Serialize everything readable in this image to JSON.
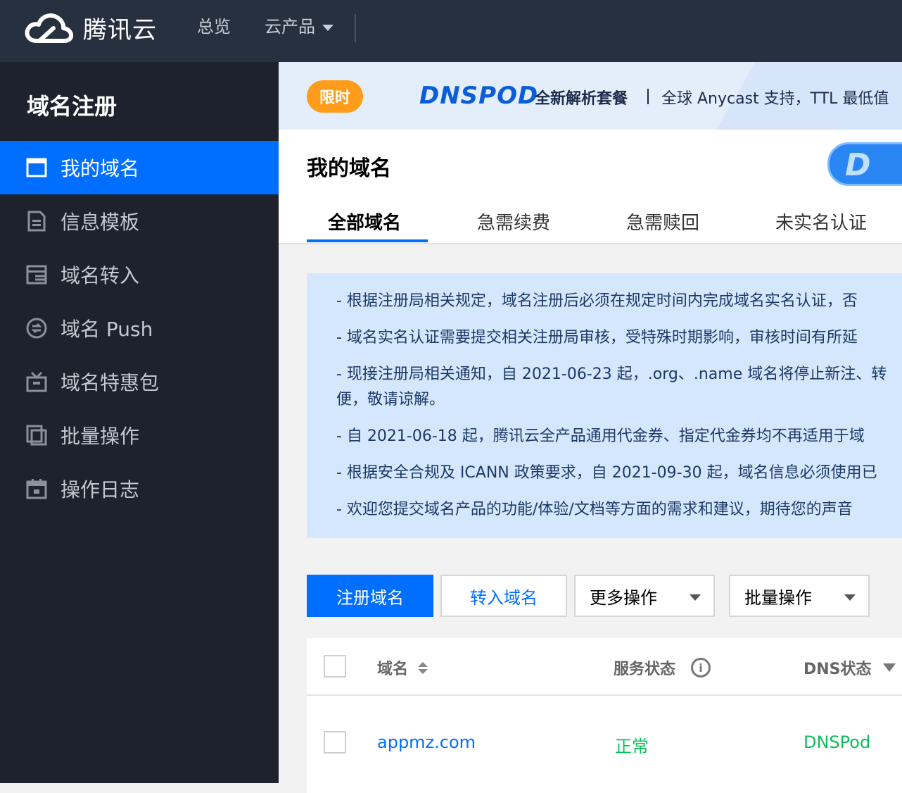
{
  "header": {
    "brand": "腾讯云",
    "nav": {
      "overview": "总览",
      "products": "云产品"
    }
  },
  "sidebar": {
    "title": "域名注册",
    "items": [
      {
        "label": "我的域名",
        "icon": "window-icon",
        "active": true
      },
      {
        "label": "信息模板",
        "icon": "document-icon"
      },
      {
        "label": "域名转入",
        "icon": "transfer-icon"
      },
      {
        "label": "域名 Push",
        "icon": "push-icon"
      },
      {
        "label": "域名特惠包",
        "icon": "gift-icon"
      },
      {
        "label": "批量操作",
        "icon": "copy-icon"
      },
      {
        "label": "操作日志",
        "icon": "calendar-icon"
      }
    ]
  },
  "banner": {
    "badge": "限时",
    "logo": "DNSPOD",
    "title": "全新解析套餐",
    "desc": "全球 Anycast 支持，TTL 最低值"
  },
  "page": {
    "title": "我的域名",
    "promo_letter": "D",
    "tabs": [
      "全部域名",
      "急需续费",
      "急需赎回",
      "未实名认证"
    ]
  },
  "notice": [
    "- 根据注册局相关规定，域名注册后必须在规定时间内完成域名实名认证，否",
    "- 域名实名认证需要提交相关注册局审核，受特殊时期影响，审核时间有所延",
    "- 现接注册局相关通知，自 2021-06-23 起，.org、.name 域名将停止新注、转",
    "便，敬请谅解。",
    "- 自 2021-06-18 起，腾讯云全产品通用代金券、指定代金券均不再适用于域",
    "- 根据安全合规及 ICANN 政策要求，自 2021-09-30 起，域名信息必须使用已",
    "- 欢迎您提交域名产品的功能/体验/文档等方面的需求和建议，期待您的声音"
  ],
  "toolbar": {
    "register": "注册域名",
    "transfer_in": "转入域名",
    "more": "更多操作",
    "batch": "批量操作"
  },
  "table": {
    "columns": {
      "domain": "域名",
      "status": "服务状态",
      "dns": "DNS状态"
    },
    "rows": [
      {
        "domain": "appmz.com",
        "status": "正常",
        "dns": "DNSPod"
      }
    ]
  },
  "colors": {
    "accent": "#006eff",
    "topbar": "#27303f",
    "sidebar": "#1e222d",
    "success": "#0abf5b",
    "badge": "#ff9c19"
  }
}
